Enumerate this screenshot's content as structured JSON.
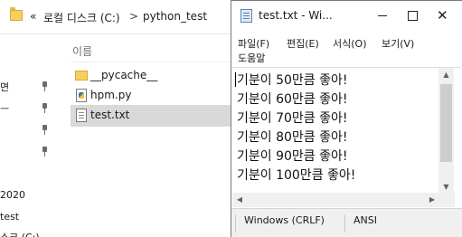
{
  "explorer": {
    "breadcrumb_sep": "«",
    "breadcrumb_drive": "로컬 디스크 (C:)",
    "breadcrumb_folder": "python_test",
    "chevron": ">",
    "column_name": "이름",
    "nav_items": [
      "면",
      "ㅡ",
      "",
      "",
      "2020",
      "test",
      "스크 (C:)"
    ],
    "files": [
      {
        "name": "__pycache__",
        "icon": "folder-icon"
      },
      {
        "name": "hpm.py",
        "icon": "python-file-icon"
      },
      {
        "name": "test.txt",
        "icon": "text-file-icon",
        "selected": true
      }
    ]
  },
  "notepad": {
    "title": "test.txt - Wi...",
    "close_glyph": "✕",
    "menu": [
      "파일(F)",
      "편집(E)",
      "서식(O)",
      "보기(V)",
      "도움말"
    ],
    "lines": [
      "기분이 50만큼 좋아!",
      "기분이 60만큼 좋아!",
      "기분이 70만큼 좋아!",
      "기분이 80만큼 좋아!",
      "기분이 90만큼 좋아!",
      "기분이 100만큼 좋아!"
    ],
    "scroll_up": "▲",
    "scroll_down": "▼",
    "scroll_left": "◀",
    "scroll_right": "▶",
    "status": {
      "line_ending": "Windows (CRLF)",
      "encoding": "ANSI"
    }
  }
}
